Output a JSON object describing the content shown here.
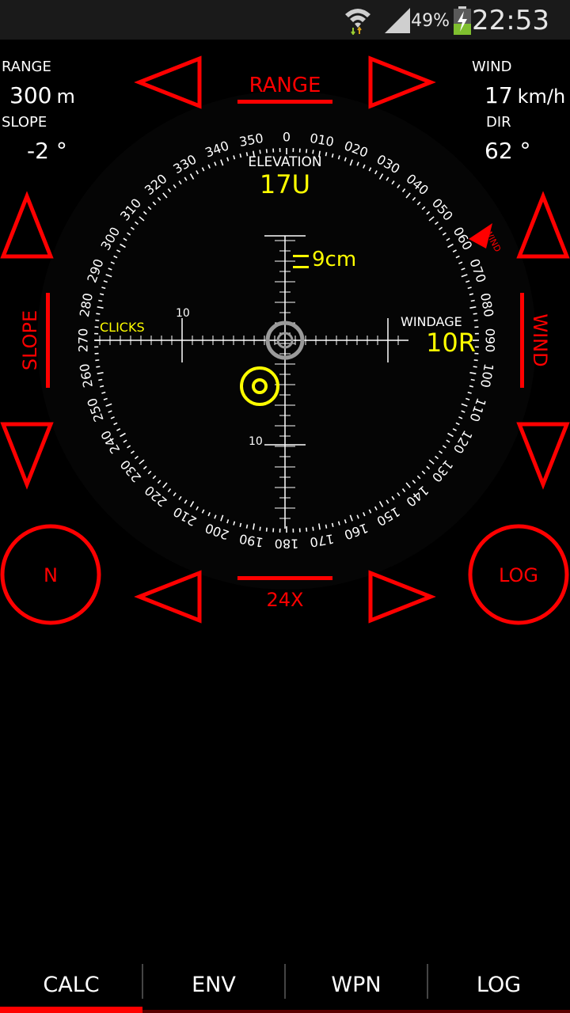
{
  "status_bar": {
    "battery_percent": "49%",
    "time": "22:53",
    "icons": [
      "wifi-icon",
      "signal-icon",
      "battery-charging-icon"
    ]
  },
  "readouts": {
    "range_label": "RANGE",
    "range_value": "300",
    "range_unit": "m",
    "slope_label": "SLOPE",
    "slope_value": "-2 °",
    "wind_label": "WIND",
    "wind_value": "17",
    "wind_unit": "km/h",
    "dir_label": "DIR",
    "dir_value": "62 °"
  },
  "controls": {
    "range_button": "RANGE",
    "slope_button": "SLOPE",
    "wind_button": "WIND",
    "magnification": "24X",
    "north_button": "N",
    "log_button": "LOG"
  },
  "reticle": {
    "elevation_label": "ELEVATION",
    "elevation_value": "17U",
    "windage_label": "WINDAGE",
    "windage_value": "10R",
    "clicks_label": "CLICKS",
    "group_size": "9cm",
    "scale_label_horizontal": "10",
    "scale_label_vertical": "10",
    "wind_marker_label": "WIND",
    "wind_direction_deg": 62,
    "compass_labels": [
      "0",
      "010",
      "020",
      "030",
      "040",
      "050",
      "060",
      "070",
      "080",
      "090",
      "100",
      "110",
      "120",
      "130",
      "140",
      "150",
      "160",
      "170",
      "180",
      "190",
      "200",
      "210",
      "220",
      "230",
      "240",
      "250",
      "260",
      "270",
      "280",
      "290",
      "300",
      "310",
      "320",
      "330",
      "340",
      "350"
    ]
  },
  "colors": {
    "accent_red": "#ff0000",
    "reticle_yellow": "#ffff00",
    "background": "#000000"
  },
  "tabs": [
    {
      "label": "CALC",
      "active": true
    },
    {
      "label": "ENV",
      "active": false
    },
    {
      "label": "WPN",
      "active": false
    },
    {
      "label": "LOG",
      "active": false
    }
  ]
}
